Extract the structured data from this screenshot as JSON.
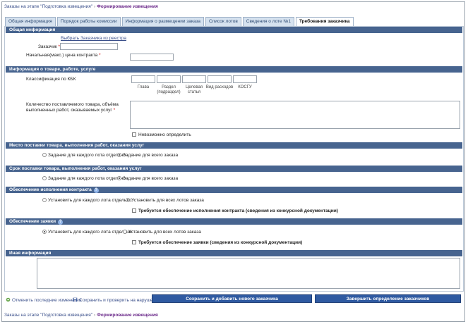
{
  "breadcrumb": {
    "parent": "Заказы на этапе \"Подготовка извещения\"",
    "separator": "›",
    "current": "Формирование извещения"
  },
  "tabs": [
    {
      "label": "Общая информация"
    },
    {
      "label": "Порядок работы комиссии"
    },
    {
      "label": "Информация о размещении заказа"
    },
    {
      "label": "Список лотов"
    },
    {
      "label": "Сведения о лоте №1"
    },
    {
      "label": "Требования заказчика"
    }
  ],
  "sections": {
    "general": "Общая информация",
    "goods": "Информация о товаре, работе, услуге",
    "place": "Место поставки товара, выполнения работ, оказания услуг",
    "term": "Срок поставки товара, выполнения работ, оказания услуг",
    "contract_security": "Обеспечение исполнения контракта",
    "bid_security": "Обеспечение заявки",
    "other": "Иная информация"
  },
  "general": {
    "select_customer_link": "Выбрать Заказчика из реестра",
    "customer_label": "Заказчик",
    "price_label": "Начальная(макс.) цена контракта",
    "required_mark": "*"
  },
  "goods": {
    "kbk_label": "Классификация по КБК",
    "kbk_columns": [
      "Глава",
      "Раздел (подраздел)",
      "Целевая статья",
      "Вид расходов",
      "КОСГУ"
    ],
    "quantity_label": "Количество поставляемого товара, объёма выполненных работ, оказываемых услуг",
    "cannot_define": "Невозможно определить"
  },
  "place": {
    "opt_each_lot": "Задание для каждого лота отдельно",
    "opt_whole": "Задание для всего заказа",
    "selected": "whole"
  },
  "term": {
    "opt_each_lot": "Задание для каждого лота отдельно",
    "opt_whole": "Задание для всего заказа",
    "selected": "whole"
  },
  "contract_security": {
    "opt_each_lot": "Установить для каждого лота отдельно",
    "opt_all": "Установить для всех лотов заказа",
    "selected": "all",
    "required_check": "Требуется обеспечение исполнения контракта (сведения из конкурсной документации)"
  },
  "bid_security": {
    "opt_each_lot": "Установить для каждого лота отдельно",
    "opt_all": "Установить для всех лотов заказа",
    "selected": "each",
    "required_check": "Требуется обеспечение заявки (сведения из конкурсной документации)"
  },
  "footer": {
    "undo": "Отменить последние изменения",
    "save_check": "Сохранить и проверить на нарушения",
    "save_add": "Сохранить и добавить нового заказчика",
    "finish": "Завершить определение заказчиков"
  },
  "colors": {
    "section_bar": "#47648f",
    "button": "#2f5aa1",
    "tab": "#d6e2ef"
  }
}
